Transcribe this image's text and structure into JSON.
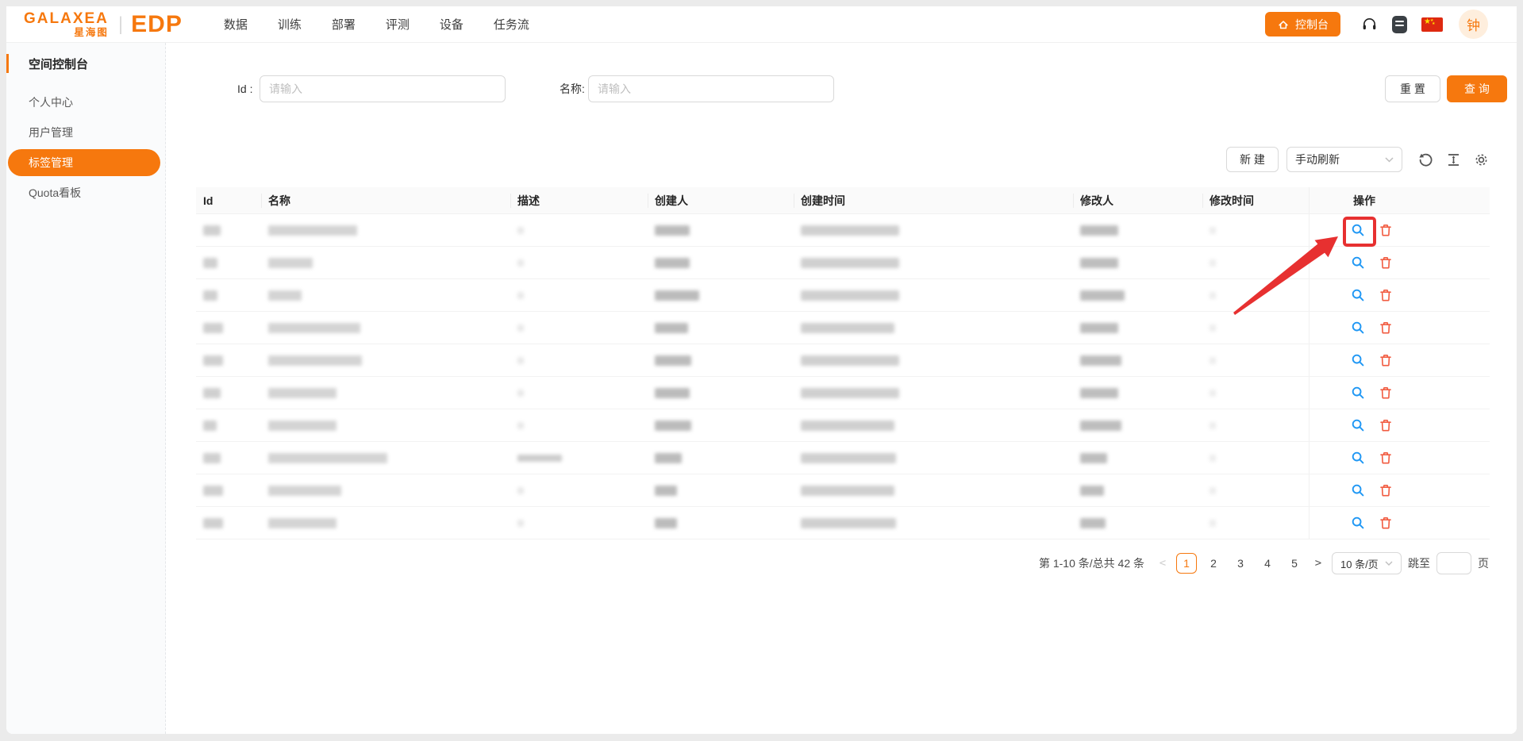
{
  "brand": {
    "logo_text": "GALAXEA",
    "logo_sub": "星海图",
    "divider": "|",
    "product": "EDP"
  },
  "nav": {
    "items": [
      "数据",
      "训练",
      "部署",
      "评测",
      "设备",
      "任务流"
    ]
  },
  "header_right": {
    "console_label": "控制台",
    "avatar_text": "钟",
    "icons": [
      "home-icon",
      "headset-icon",
      "terminal-book-icon",
      "china-flag-icon"
    ]
  },
  "sidebar": {
    "workspace": "空间控制台",
    "items": [
      {
        "label": "个人中心",
        "active": false
      },
      {
        "label": "用户管理",
        "active": false
      },
      {
        "label": "标签管理",
        "active": true
      },
      {
        "label": "Quota看板",
        "active": false
      }
    ]
  },
  "filters": {
    "id_label": "Id :",
    "name_label": "名称:",
    "placeholder": "请输入",
    "reset_label": "重 置",
    "search_label": "查 询"
  },
  "toolbar": {
    "new_label": "新 建",
    "refresh_mode": "手动刷新",
    "icons": [
      "reload-icon",
      "column-height-icon",
      "gear-icon"
    ]
  },
  "table": {
    "columns": [
      "Id",
      "名称",
      "描述",
      "创建人",
      "创建时间",
      "修改人",
      "修改时间",
      "操作"
    ],
    "rows": [
      {
        "blobs": [
          22,
          112,
          8,
          44,
          124,
          48,
          8
        ]
      },
      {
        "blobs": [
          18,
          56,
          8,
          44,
          124,
          48,
          8
        ]
      },
      {
        "blobs": [
          18,
          42,
          8,
          56,
          124,
          56,
          8
        ]
      },
      {
        "blobs": [
          25,
          116,
          8,
          42,
          118,
          48,
          8
        ]
      },
      {
        "blobs": [
          25,
          118,
          8,
          46,
          124,
          52,
          8
        ]
      },
      {
        "blobs": [
          22,
          86,
          8,
          44,
          124,
          48,
          8
        ]
      },
      {
        "blobs": [
          17,
          86,
          8,
          46,
          118,
          52,
          8
        ]
      },
      {
        "blobs": [
          22,
          150,
          56,
          34,
          120,
          34,
          8
        ]
      },
      {
        "blobs": [
          25,
          92,
          8,
          28,
          118,
          30,
          8
        ]
      },
      {
        "blobs": [
          25,
          86,
          8,
          28,
          120,
          32,
          8
        ]
      }
    ],
    "row_actions": [
      "magnifier-icon",
      "trash-icon"
    ]
  },
  "pagination": {
    "total_text": "第 1-10 条/总共 42 条",
    "prev": "<",
    "pages": [
      "1",
      "2",
      "3",
      "4",
      "5"
    ],
    "active_page": "1",
    "next": ">",
    "page_size": "10 条/页",
    "jump_label": "跳至",
    "jump_suffix": "页"
  },
  "annotation": {
    "type": "highlight-box-with-arrow",
    "target": "first-row-view-button",
    "color": "#e73030"
  },
  "colors": {
    "accent": "#f6780e",
    "link_blue": "#1f97f4",
    "danger": "#f15b40",
    "annotation_red": "#e73030"
  }
}
